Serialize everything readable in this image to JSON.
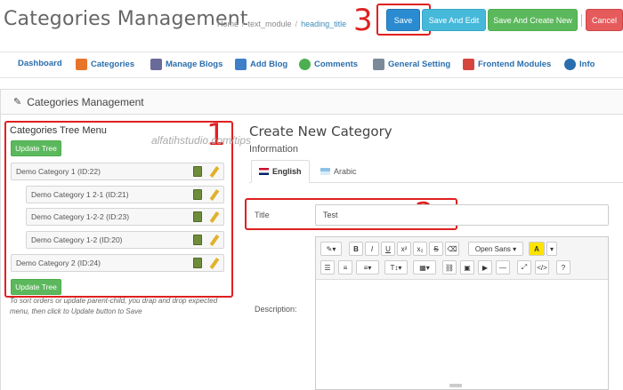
{
  "header": {
    "title": "Categories Management",
    "breadcrumb": [
      "Home",
      "text_module",
      "heading_title"
    ],
    "buttons": {
      "save": "Save",
      "save_edit": "Save And Edit",
      "save_new": "Save And Create New",
      "cancel": "Cancel"
    }
  },
  "annotations": {
    "a1": "1",
    "a2": "2",
    "a3": "3"
  },
  "watermark": "alfatihstudio.com/tips",
  "nav": [
    {
      "label": "Dashboard",
      "icon": "dashboard-icon",
      "color": ""
    },
    {
      "label": "Categories",
      "icon": "folder-add-icon",
      "color": "#e8742a"
    },
    {
      "label": "Manage Blogs",
      "icon": "pen-icon",
      "color": "#6a6a9a"
    },
    {
      "label": "Add Blog",
      "icon": "add-document-icon",
      "color": "#3f7fc8"
    },
    {
      "label": "Comments",
      "icon": "comments-icon",
      "color": "#4caf50"
    },
    {
      "label": "General Setting",
      "icon": "tools-icon",
      "color": "#7a8a99"
    },
    {
      "label": "Frontend Modules",
      "icon": "modules-icon",
      "color": "#d6453d"
    },
    {
      "label": "Info",
      "icon": "info-icon",
      "color": "#2a6ead"
    }
  ],
  "panel": {
    "title": "Categories Management"
  },
  "tree": {
    "title": "Categories Tree Menu",
    "update_label": "Update Tree",
    "items": [
      {
        "label": "Demo Category 1 (ID:22)"
      },
      {
        "label": "Demo Category 1 2-1 (ID:21)"
      },
      {
        "label": "Demo Category 1-2-2 (ID:23)"
      },
      {
        "label": "Demo Category 1-2 (ID:20)"
      },
      {
        "label": "Demo Category 2 (ID:24)"
      }
    ],
    "help": "To sort orders or update parent-child, you drap and drop expected menu, then click to Update button to Save"
  },
  "form": {
    "title": "Create New Category",
    "info_label": "Information",
    "tabs": [
      {
        "label": "English"
      },
      {
        "label": "Arabic"
      }
    ],
    "title_label": "Title",
    "title_value": "Test",
    "description_label": "Description:",
    "editor": {
      "font_value": "Open Sans",
      "color_label": "A"
    }
  }
}
